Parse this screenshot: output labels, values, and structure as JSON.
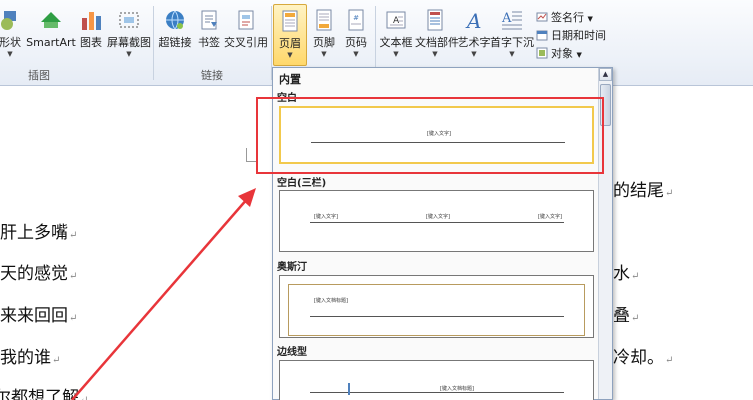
{
  "ribbon": {
    "illustrations": {
      "shapes_label": "形状",
      "smartart_label": "SmartArt",
      "chart_label": "图表",
      "screenshot_label": "屏幕截图",
      "group_label": "插图"
    },
    "links": {
      "hyperlink_label": "超链接",
      "bookmark_label": "书签",
      "crossref_label": "交叉引用",
      "group_label": "链接"
    },
    "header_footer": {
      "header_label": "页眉",
      "footer_label": "页脚",
      "page_number_label": "页码"
    },
    "text": {
      "textbox_label": "文本框",
      "quickparts_label": "文档部件",
      "wordart_label": "艺术字",
      "dropcap_label": "首字下沉",
      "signature_label": "签名行",
      "datetime_label": "日期和时间",
      "object_label": "对象"
    }
  },
  "gallery": {
    "section_title": "内置",
    "items": [
      {
        "label": "空白",
        "placeholder": "[键入文字]"
      },
      {
        "label": "空白(三栏)",
        "placeholder": "[键入文字]"
      },
      {
        "label": "奥斯汀",
        "placeholder": "[键入文档标题]"
      },
      {
        "label": "边线型",
        "placeholder": "[键入文档标题]"
      }
    ]
  },
  "document": {
    "lines_left": [
      "肝上多嘴",
      "天的感觉",
      "来来回回",
      "我的谁",
      "尔都想了解"
    ],
    "lines_right": [
      "的结尾",
      "水",
      "叠",
      "冷却。"
    ]
  },
  "colors": {
    "highlight_border": "#e8353a",
    "arrow": "#e8353a",
    "selected_thumb": "#f2c94c"
  }
}
